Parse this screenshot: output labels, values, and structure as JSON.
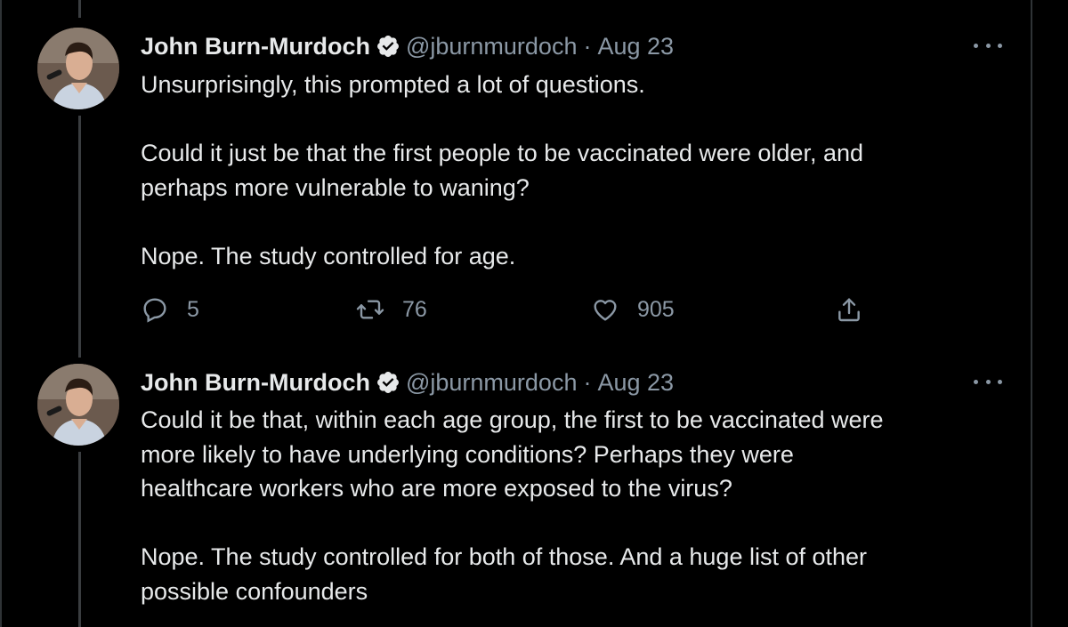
{
  "tweets": [
    {
      "author": "John Burn-Murdoch",
      "handle": "@jburnmurdoch",
      "separator": "·",
      "date": "Aug 23",
      "paragraphs": [
        "Unsurprisingly, this prompted a lot of questions.",
        "Could it just be that the first people to be vaccinated were older, and\nperhaps more vulnerable to waning?",
        "Nope. The study controlled for age."
      ],
      "replies": "5",
      "retweets": "76",
      "likes": "905"
    },
    {
      "author": "John Burn-Murdoch",
      "handle": "@jburnmurdoch",
      "separator": "·",
      "date": "Aug 23",
      "paragraphs": [
        "Could it be that, within each age group, the first to be vaccinated were\nmore likely to have underlying conditions? Perhaps they were\nhealthcare workers who are more exposed to the virus?",
        "Nope. The study controlled for both of those. And a huge list of other\npossible confounders"
      ]
    }
  ],
  "icons": {
    "verified": "verified-badge-icon",
    "more": "more-options-icon",
    "reply": "reply-icon",
    "retweet": "retweet-icon",
    "like": "heart-icon",
    "share": "share-icon"
  },
  "colors": {
    "background": "#000000",
    "text": "#e7e9ea",
    "secondary": "#8b98a5",
    "thread_line": "#3a3d40"
  }
}
